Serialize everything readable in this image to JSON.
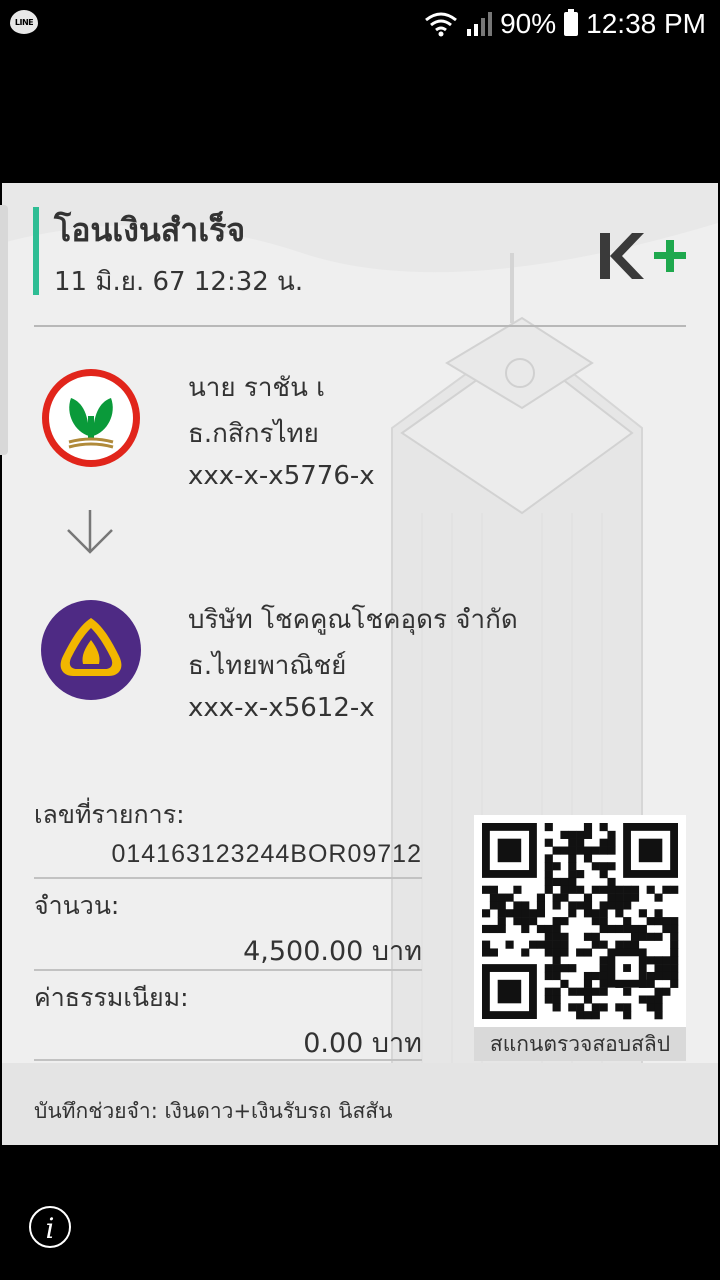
{
  "status_bar": {
    "app_icon_label": "LINE",
    "battery_percent": "90%",
    "time": "12:38 PM"
  },
  "slip": {
    "title": "โอนเงินสำเร็จ",
    "datetime": "11 มิ.ย. 67  12:32 น.",
    "brand": "K+",
    "accent_color": "#2ebd94",
    "sender": {
      "name": "นาย ราชัน เ",
      "bank": "ธ.กสิกรไทย",
      "account": "xxx-x-x5776-x",
      "logo": "kasikornbank-logo"
    },
    "receiver": {
      "name": "บริษัท โชคคูณโชคอุดร จำกัด",
      "bank": "ธ.ไทยพาณิชย์",
      "account": "xxx-x-x5612-x",
      "logo": "scb-logo"
    },
    "reference_label": "เลขที่รายการ:",
    "reference_value": "014163123244BOR09712",
    "amount_label": "จำนวน:",
    "amount_value": "4,500.00 บาท",
    "fee_label": "ค่าธรรมเนียม:",
    "fee_value": "0.00 บาท",
    "qr_caption": "สแกนตรวจสอบสลิป",
    "memo_label": "บันทึกช่วยจำ:",
    "memo_value": " เงินดาว+เงินรับรถ นิสสัน"
  },
  "footer": {
    "info_icon": "i"
  }
}
